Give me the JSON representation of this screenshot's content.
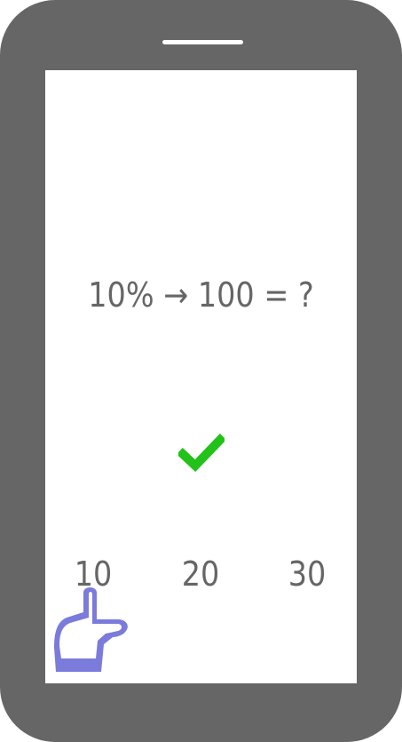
{
  "question": {
    "text": "10% → 100 = ?"
  },
  "feedback": {
    "icon": "checkmark-icon",
    "color": "#22c21a"
  },
  "options": [
    {
      "label": "10"
    },
    {
      "label": "20"
    },
    {
      "label": "30"
    }
  ],
  "pointer": {
    "icon": "pointing-hand-icon",
    "color": "#7b7bdb"
  },
  "colors": {
    "device_frame": "#666666",
    "screen": "#ffffff",
    "text": "#666666"
  }
}
